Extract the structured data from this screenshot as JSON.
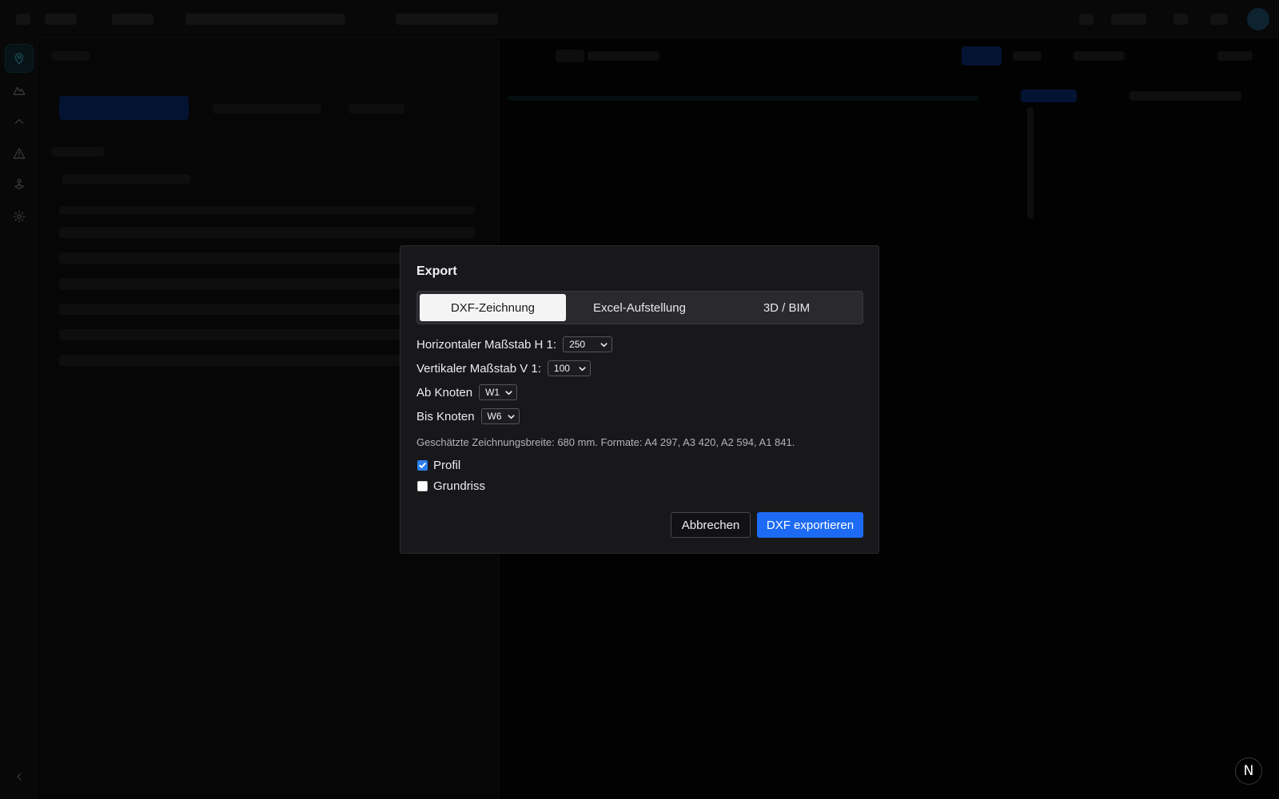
{
  "dialog": {
    "title": "Export",
    "tabs": [
      {
        "label": "DXF-Zeichnung",
        "active": true
      },
      {
        "label": "Excel-Aufstellung",
        "active": false
      },
      {
        "label": "3D / BIM",
        "active": false
      }
    ],
    "fields": {
      "h_scale": {
        "label": "Horizontaler Maßstab H 1:",
        "value": "250"
      },
      "v_scale": {
        "label": "Vertikaler Maßstab V 1:",
        "value": "100"
      },
      "from_node": {
        "label": "Ab Knoten",
        "value": "W1"
      },
      "to_node": {
        "label": "Bis Knoten",
        "value": "W6"
      }
    },
    "info": "Geschätzte Zeichnungsbreite: 680 mm. Formate: A4 297, A3 420, A2 594, A1 841.",
    "checkboxes": {
      "profil": {
        "label": "Profil",
        "checked": true
      },
      "grundriss": {
        "label": "Grundriss",
        "checked": false
      }
    },
    "buttons": {
      "cancel": "Abbrechen",
      "primary": "DXF exportieren"
    }
  },
  "sidebar": {
    "items": [
      {
        "icon": "map-pin-icon",
        "active": true
      },
      {
        "icon": "terrain-icon",
        "active": false
      },
      {
        "icon": "chevron-up-icon",
        "active": false
      },
      {
        "icon": "warning-icon",
        "active": false
      },
      {
        "icon": "joystick-icon",
        "active": false
      },
      {
        "icon": "gear-icon",
        "active": false
      }
    ]
  },
  "badge": {
    "letter": "N"
  },
  "colors": {
    "accent": "#1d6bf5",
    "active_icon": "#3fb6cf",
    "dialog_bg": "#18181b"
  }
}
